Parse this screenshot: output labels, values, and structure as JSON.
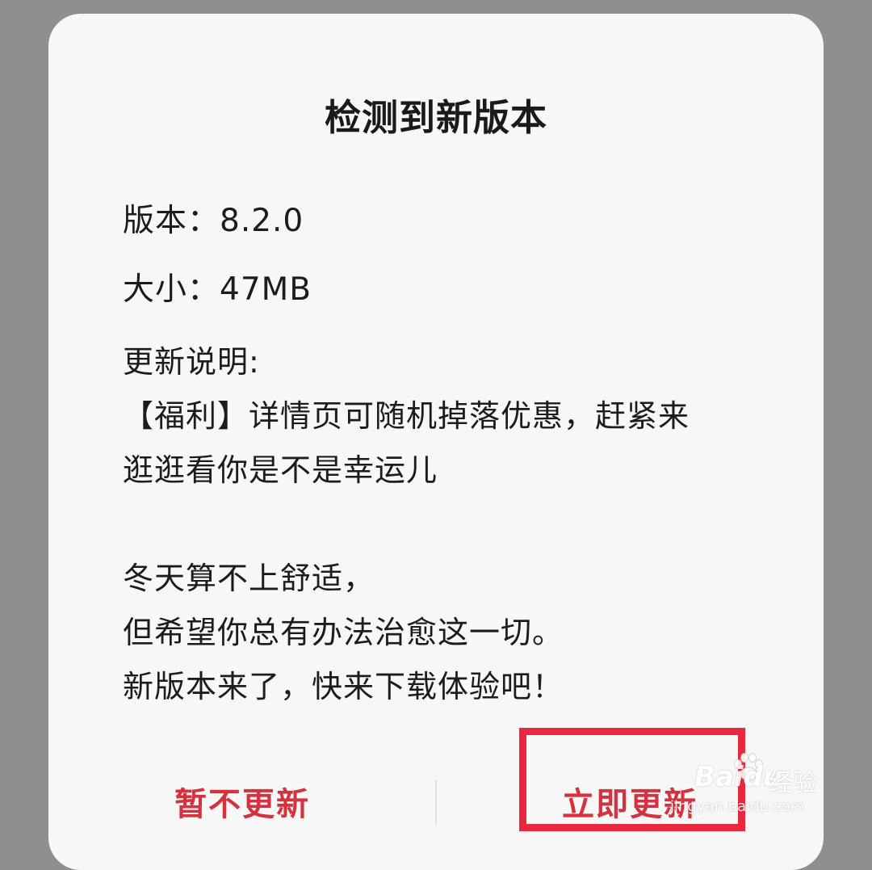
{
  "dialog": {
    "title": "检测到新版本",
    "version_line": "版本：8.2.0",
    "size_line": "大小：47MB",
    "notes_heading": "更新说明:",
    "notes": [
      "【福利】详情页可随机掉落优惠，赶紧来",
      "逛逛看你是不是幸运儿",
      "",
      "冬天算不上舒适，",
      "但希望你总有办法治愈这一切。",
      "新版本来了，快来下载体验吧！"
    ],
    "buttons": {
      "later": "暂不更新",
      "now": "立即更新"
    }
  },
  "colors": {
    "accent": "#d4323f",
    "highlight": "#e8283f",
    "overlay": "#8f8f8f",
    "dialog_bg": "#f7f7f7"
  },
  "watermark": {
    "brand": "Baidu",
    "cn": "经验",
    "url": "jingyan.baidu.com",
    "icon": "paw-icon"
  }
}
